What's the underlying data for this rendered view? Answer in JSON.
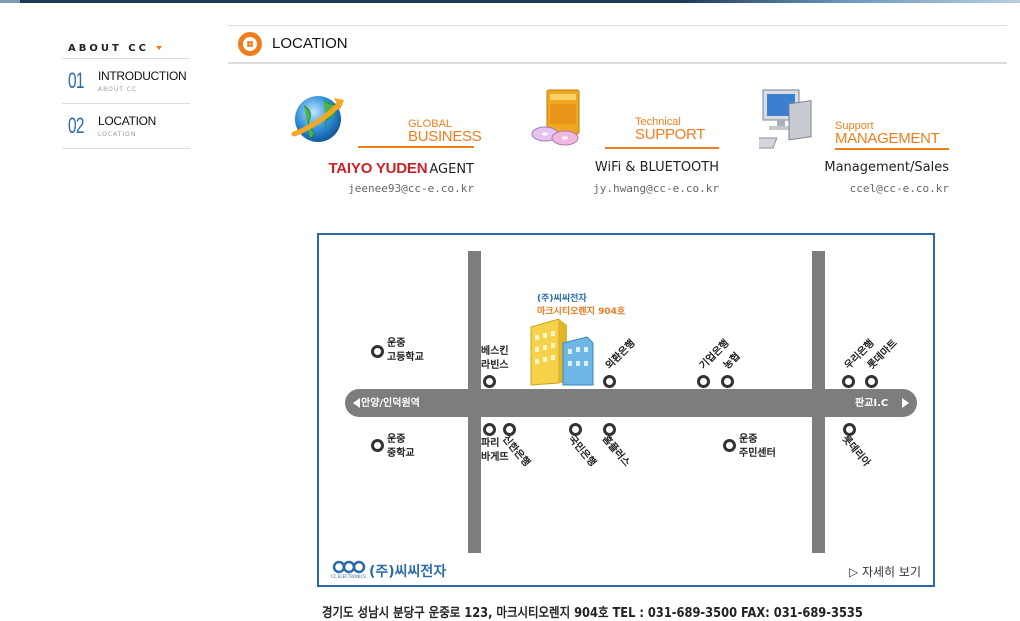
{
  "sidebar": {
    "title": "ABOUT CC",
    "items": [
      {
        "num": "01",
        "label": "INTRODUCTION",
        "sub": "ABOUT CC"
      },
      {
        "num": "02",
        "label": "LOCATION",
        "sub": "LOCATION"
      }
    ]
  },
  "header": {
    "title": "LOCATION"
  },
  "blocks": [
    {
      "cat1": "GLOBAL",
      "cat2": "BUSINESS",
      "brand": "TAIYO YUDEN",
      "desc": "AGENT",
      "email": "jeenee93@cc-e.co.kr",
      "icon": "globe-icon"
    },
    {
      "cat1": "Technical",
      "cat2": "SUPPORT",
      "desc": "WiFi & BLUETOOTH",
      "email": "jy.hwang@cc-e.co.kr",
      "icon": "software-icon"
    },
    {
      "cat1": "Support",
      "cat2": "MANAGEMENT",
      "desc": "Management/Sales",
      "email": "ccel@cc-e.co.kr",
      "icon": "computer-icon"
    }
  ],
  "map": {
    "building": {
      "company": "(주)씨씨전자",
      "address": "마크시티오렌지 904호"
    },
    "road_left": "안양/인덕원역",
    "road_right": "판교I.C",
    "pois": {
      "school_high": "운중\n고등학교",
      "school_mid": "운중\n중학교",
      "baskin": "베스킨\n라빈스",
      "exchange_bank": "외환은행",
      "ibk": "기업은행",
      "nh": "농협",
      "woori": "우리은행",
      "lotte_mart": "롯데마트",
      "paris": "파리\n바게뜨",
      "shinhan": "신한은행",
      "kb": "국민은행",
      "homeplus": "홈플러스",
      "center": "운중\n주민센터",
      "lotteria": "롯데리아"
    },
    "logo_sub": "CC ELECTRONICS",
    "logo_name": "(주)씨씨전자",
    "detail_link": "▷ 자세히 보기"
  },
  "footer": {
    "address": "경기도 성남시 분당구 운중로 123, 마크시티오렌지 904호 TEL : 031-689-3500 FAX: 031-689-3535"
  },
  "colors": {
    "accent": "#f07d1c",
    "brand_blue": "#2a6aa9",
    "road": "#7d7d7d"
  }
}
